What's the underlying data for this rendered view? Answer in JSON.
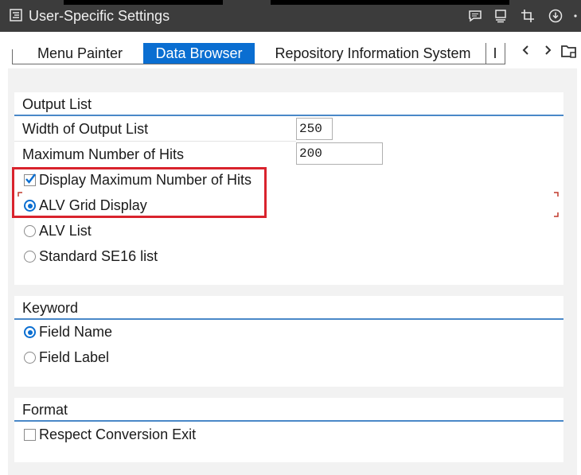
{
  "window": {
    "title": "User-Specific Settings",
    "toolbar_icons": [
      "chat-icon",
      "monitor-icon",
      "crop-icon",
      "download-icon",
      "more-icon"
    ]
  },
  "tabs": [
    {
      "label": "Menu Painter",
      "active": false
    },
    {
      "label": "Data Browser",
      "active": true
    },
    {
      "label": "Repository Information System",
      "active": false
    },
    {
      "label": "I",
      "active": false
    }
  ],
  "output_list": {
    "header": "Output List",
    "width_label": "Width of Output List",
    "width_value": "250",
    "max_hits_label": "Maximum Number of Hits",
    "max_hits_value": "200",
    "display_max_label": "Display Maximum Number of Hits",
    "display_max_checked": true,
    "options": [
      {
        "label": "ALV Grid Display",
        "selected": true
      },
      {
        "label": "ALV List",
        "selected": false
      },
      {
        "label": "Standard SE16 list",
        "selected": false
      }
    ]
  },
  "keyword": {
    "header": "Keyword",
    "options": [
      {
        "label": "Field Name",
        "selected": true
      },
      {
        "label": "Field Label",
        "selected": false
      }
    ]
  },
  "format": {
    "header": "Format",
    "respect_conversion_label": "Respect Conversion Exit",
    "respect_conversion_checked": false
  },
  "colors": {
    "accent": "#0a6ed1",
    "highlight": "#d9232d",
    "titlebar": "#3c3c3c"
  }
}
